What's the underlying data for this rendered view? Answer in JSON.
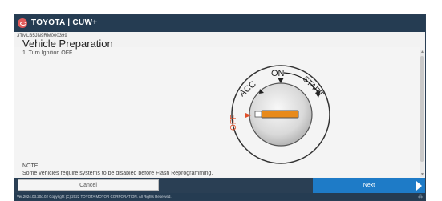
{
  "header": {
    "brand": "TOYOTA | CUW+"
  },
  "vehicle": {
    "vin": "3TMLB5JN9RM000399"
  },
  "page": {
    "title": "Vehicle Preparation",
    "step": "1. Turn Ignition OFF"
  },
  "ignition": {
    "positions": [
      "OFF",
      "ACC",
      "ON",
      "START"
    ],
    "current": "OFF"
  },
  "note": {
    "label": "NOTE:",
    "text": "Some vehicles require systems to be disabled before Flash Reprogramming."
  },
  "buttons": {
    "cancel": "Cancel",
    "next": "Next"
  },
  "footer": {
    "text": "Ver.2024.03.20d.02 Copyright (C) 2022 TOYOTA MOTOR CORPORATION. All Rights Reserved."
  },
  "colors": {
    "header": "#253c52",
    "next_button": "#1e7bc7",
    "off_label": "#e0502a",
    "key_slot": "#e88a1a"
  },
  "icons": {
    "logo": "toyota-logo-icon",
    "next_arrow": "triangle-right-icon",
    "status": "network-icon"
  }
}
